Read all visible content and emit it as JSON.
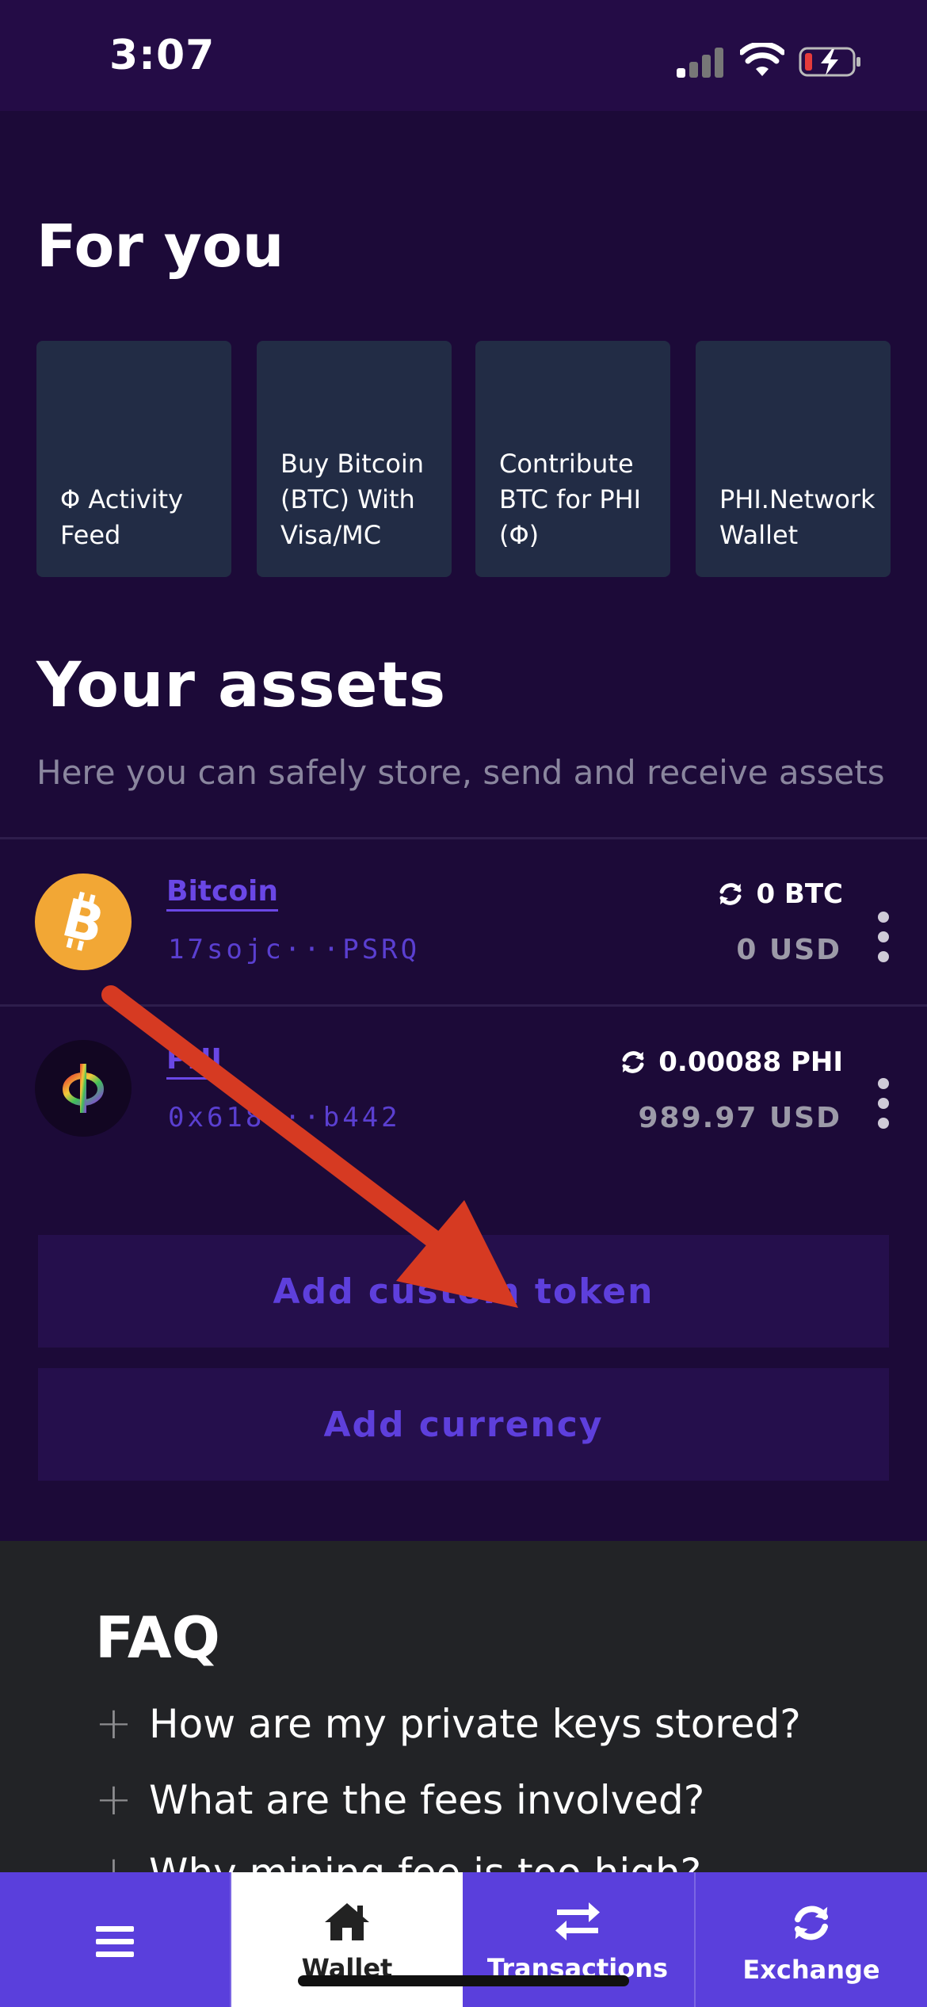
{
  "status_bar": {
    "time": "3:07"
  },
  "for_you": {
    "title": "For you",
    "cards": [
      {
        "label": "Φ Activity Feed"
      },
      {
        "label": "Buy Bitcoin (BTC) With Visa/MC"
      },
      {
        "label": "Contribute BTC for PHI (Φ)"
      },
      {
        "label": "PHI.Network Wallet"
      }
    ]
  },
  "assets": {
    "title": "Your assets",
    "subtitle": "Here you can safely store, send and receive assets",
    "items": [
      {
        "name": "Bitcoin",
        "address": "17sojc···PSRQ",
        "amount": "0 BTC",
        "usd": "0 USD",
        "icon": "bitcoin-icon"
      },
      {
        "name": "PHI",
        "address": "0x618···b442",
        "amount": "0.00088 PHI",
        "usd": "989.97 USD",
        "icon": "phi-icon"
      }
    ]
  },
  "actions": {
    "add_custom_token": "Add custom token",
    "add_currency": "Add currency"
  },
  "faq": {
    "title": "FAQ",
    "items": [
      "How are my private keys stored?",
      "What are the fees involved?",
      "Why mining fee is too high?"
    ]
  },
  "tab_bar": {
    "tabs": [
      {
        "label": "",
        "icon": "menu-icon"
      },
      {
        "label": "Wallet",
        "icon": "home-icon",
        "active": true
      },
      {
        "label": "Transactions",
        "icon": "transfer-arrows-icon"
      },
      {
        "label": "Exchange",
        "icon": "refresh-icon"
      }
    ]
  },
  "colors": {
    "background": "#1c0a38",
    "accent": "#5a3fdc",
    "card": "#222c45",
    "annotation_arrow": "#d63a22"
  }
}
